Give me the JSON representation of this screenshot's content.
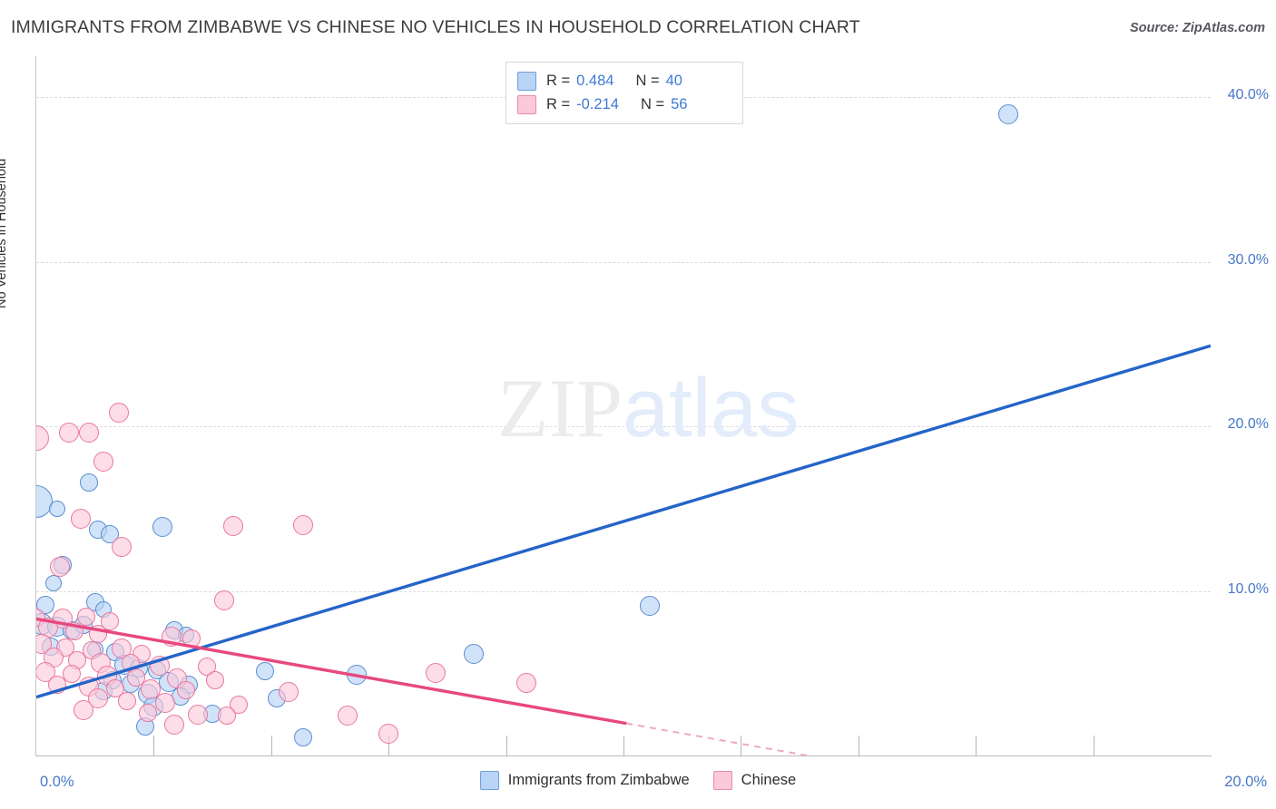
{
  "header": {
    "title": "IMMIGRANTS FROM ZIMBABWE VS CHINESE NO VEHICLES IN HOUSEHOLD CORRELATION CHART",
    "source": "Source: ZipAtlas.com"
  },
  "watermark": {
    "part1": "ZIP",
    "part2": "atlas"
  },
  "stats": {
    "rows": [
      {
        "color": "blue",
        "r_label": "R =",
        "r_value": "0.484",
        "n_label": "N =",
        "n_value": "40"
      },
      {
        "color": "pink",
        "r_label": "R =",
        "r_value": "-0.214",
        "n_label": "N =",
        "n_value": "56"
      }
    ]
  },
  "legend": {
    "items": [
      {
        "label": "Immigrants from Zimbabwe",
        "color": "blue",
        "hex": "#bad4f5"
      },
      {
        "label": "Chinese",
        "color": "pink",
        "hex": "#fbc9d9"
      }
    ]
  },
  "colors": {
    "blue_fill": "#bad4f5",
    "blue_stroke": "#5b8ed0",
    "blue_line": "#2564c8",
    "pink_fill": "#fbc9d9",
    "pink_stroke": "#e8789f",
    "pink_line": "#e8487f",
    "tick_text": "#4777c8",
    "grid": "#dcdcdc"
  },
  "chart_data": {
    "type": "scatter",
    "title": "IMMIGRANTS FROM ZIMBABWE VS CHINESE NO VEHICLES IN HOUSEHOLD CORRELATION CHART",
    "xlabel": "",
    "ylabel": "No Vehicles in Household",
    "xlim": [
      0.0,
      20.0
    ],
    "ylim": [
      0.0,
      42.5
    ],
    "x_ticks": [
      0.0,
      20.0
    ],
    "x_tick_labels": [
      "0.0%",
      "20.0%"
    ],
    "x_minor_ticks": [
      2.0,
      4.0,
      6.0,
      8.0,
      10.0,
      12.0,
      14.0,
      16.0,
      18.0
    ],
    "y_ticks": [
      10.0,
      20.0,
      30.0,
      40.0
    ],
    "y_tick_labels": [
      "10.0%",
      "20.0%",
      "30.0%",
      "40.0%"
    ],
    "grid": "horizontal-dashed",
    "legend_position": "bottom-center",
    "series": [
      {
        "name": "Immigrants from Zimbabwe",
        "color": "#bad4f5",
        "r": 0.484,
        "n": 40,
        "trendline": {
          "x0": 0.0,
          "y0": 3.55,
          "x1": 20.0,
          "y1": 24.9,
          "style": "solid",
          "color": "#2564c8"
        },
        "points": [
          {
            "x": 16.55,
            "y": 38.95,
            "r": 11
          },
          {
            "x": 0.0,
            "y": 15.45,
            "r": 18
          },
          {
            "x": 0.9,
            "y": 16.6,
            "r": 10
          },
          {
            "x": 0.35,
            "y": 15.0,
            "r": 9
          },
          {
            "x": 2.15,
            "y": 13.9,
            "r": 11
          },
          {
            "x": 1.05,
            "y": 13.75,
            "r": 10
          },
          {
            "x": 1.25,
            "y": 13.45,
            "r": 10
          },
          {
            "x": 0.45,
            "y": 11.55,
            "r": 10
          },
          {
            "x": 0.3,
            "y": 10.45,
            "r": 9
          },
          {
            "x": 0.15,
            "y": 9.15,
            "r": 10
          },
          {
            "x": 1.0,
            "y": 9.3,
            "r": 10
          },
          {
            "x": 1.15,
            "y": 8.9,
            "r": 9
          },
          {
            "x": 10.45,
            "y": 9.1,
            "r": 11
          },
          {
            "x": 0.1,
            "y": 8.0,
            "r": 12
          },
          {
            "x": 0.35,
            "y": 7.85,
            "r": 11
          },
          {
            "x": 0.6,
            "y": 7.6,
            "r": 10
          },
          {
            "x": 0.8,
            "y": 7.95,
            "r": 10
          },
          {
            "x": 2.35,
            "y": 7.6,
            "r": 10
          },
          {
            "x": 2.55,
            "y": 7.35,
            "r": 9
          },
          {
            "x": 0.25,
            "y": 6.6,
            "r": 10
          },
          {
            "x": 1.0,
            "y": 6.45,
            "r": 9
          },
          {
            "x": 1.35,
            "y": 6.3,
            "r": 10
          },
          {
            "x": 7.45,
            "y": 6.2,
            "r": 11
          },
          {
            "x": 1.5,
            "y": 5.5,
            "r": 11
          },
          {
            "x": 1.75,
            "y": 5.3,
            "r": 10
          },
          {
            "x": 2.05,
            "y": 5.2,
            "r": 10
          },
          {
            "x": 3.9,
            "y": 5.1,
            "r": 10
          },
          {
            "x": 5.45,
            "y": 4.9,
            "r": 11
          },
          {
            "x": 1.3,
            "y": 4.55,
            "r": 10
          },
          {
            "x": 1.6,
            "y": 4.35,
            "r": 10
          },
          {
            "x": 2.25,
            "y": 4.45,
            "r": 11
          },
          {
            "x": 2.6,
            "y": 4.3,
            "r": 10
          },
          {
            "x": 1.15,
            "y": 3.9,
            "r": 10
          },
          {
            "x": 1.9,
            "y": 3.75,
            "r": 11
          },
          {
            "x": 2.45,
            "y": 3.6,
            "r": 10
          },
          {
            "x": 4.1,
            "y": 3.45,
            "r": 10
          },
          {
            "x": 2.0,
            "y": 2.95,
            "r": 11
          },
          {
            "x": 3.0,
            "y": 2.55,
            "r": 10
          },
          {
            "x": 1.85,
            "y": 1.75,
            "r": 10
          },
          {
            "x": 4.55,
            "y": 1.1,
            "r": 10
          }
        ]
      },
      {
        "name": "Chinese",
        "color": "#fbc9d9",
        "r": -0.214,
        "n": 56,
        "trendline": {
          "x0": 0.0,
          "y0": 8.3,
          "x1": 10.05,
          "y1": 1.95,
          "style": "solid",
          "color": "#e8487f"
        },
        "trendline_dashed": {
          "x0": 10.05,
          "y0": 1.95,
          "x1": 13.2,
          "y1": -0.05,
          "style": "dashed",
          "color": "#eda9c0"
        },
        "points": [
          {
            "x": 1.4,
            "y": 20.85,
            "r": 11
          },
          {
            "x": 0.0,
            "y": 19.3,
            "r": 14
          },
          {
            "x": 0.55,
            "y": 19.6,
            "r": 11
          },
          {
            "x": 0.9,
            "y": 19.6,
            "r": 11
          },
          {
            "x": 1.15,
            "y": 17.85,
            "r": 11
          },
          {
            "x": 0.75,
            "y": 14.4,
            "r": 11
          },
          {
            "x": 3.35,
            "y": 13.95,
            "r": 11
          },
          {
            "x": 4.55,
            "y": 14.0,
            "r": 11
          },
          {
            "x": 1.45,
            "y": 12.7,
            "r": 11
          },
          {
            "x": 0.4,
            "y": 11.45,
            "r": 11
          },
          {
            "x": 3.2,
            "y": 9.45,
            "r": 11
          },
          {
            "x": 0.0,
            "y": 8.4,
            "r": 10
          },
          {
            "x": 0.45,
            "y": 8.35,
            "r": 11
          },
          {
            "x": 0.85,
            "y": 8.45,
            "r": 10
          },
          {
            "x": 1.25,
            "y": 8.15,
            "r": 10
          },
          {
            "x": 0.2,
            "y": 7.75,
            "r": 11
          },
          {
            "x": 0.65,
            "y": 7.55,
            "r": 10
          },
          {
            "x": 1.05,
            "y": 7.4,
            "r": 10
          },
          {
            "x": 2.3,
            "y": 7.2,
            "r": 11
          },
          {
            "x": 2.65,
            "y": 7.1,
            "r": 10
          },
          {
            "x": 0.1,
            "y": 6.8,
            "r": 11
          },
          {
            "x": 0.5,
            "y": 6.55,
            "r": 10
          },
          {
            "x": 0.95,
            "y": 6.4,
            "r": 10
          },
          {
            "x": 1.45,
            "y": 6.5,
            "r": 11
          },
          {
            "x": 1.8,
            "y": 6.2,
            "r": 10
          },
          {
            "x": 0.3,
            "y": 5.95,
            "r": 11
          },
          {
            "x": 0.7,
            "y": 5.8,
            "r": 10
          },
          {
            "x": 1.1,
            "y": 5.6,
            "r": 11
          },
          {
            "x": 1.6,
            "y": 5.65,
            "r": 10
          },
          {
            "x": 2.1,
            "y": 5.45,
            "r": 11
          },
          {
            "x": 2.9,
            "y": 5.4,
            "r": 10
          },
          {
            "x": 0.15,
            "y": 5.05,
            "r": 11
          },
          {
            "x": 0.6,
            "y": 4.95,
            "r": 10
          },
          {
            "x": 1.2,
            "y": 4.85,
            "r": 11
          },
          {
            "x": 1.7,
            "y": 4.75,
            "r": 10
          },
          {
            "x": 2.4,
            "y": 4.7,
            "r": 11
          },
          {
            "x": 3.05,
            "y": 4.6,
            "r": 10
          },
          {
            "x": 6.8,
            "y": 5.0,
            "r": 11
          },
          {
            "x": 0.35,
            "y": 4.3,
            "r": 10
          },
          {
            "x": 0.9,
            "y": 4.2,
            "r": 11
          },
          {
            "x": 1.35,
            "y": 4.1,
            "r": 10
          },
          {
            "x": 1.95,
            "y": 4.0,
            "r": 11
          },
          {
            "x": 2.55,
            "y": 3.95,
            "r": 10
          },
          {
            "x": 4.3,
            "y": 3.85,
            "r": 11
          },
          {
            "x": 8.35,
            "y": 4.4,
            "r": 11
          },
          {
            "x": 1.05,
            "y": 3.5,
            "r": 11
          },
          {
            "x": 1.55,
            "y": 3.3,
            "r": 10
          },
          {
            "x": 2.2,
            "y": 3.2,
            "r": 11
          },
          {
            "x": 3.45,
            "y": 3.1,
            "r": 10
          },
          {
            "x": 0.8,
            "y": 2.75,
            "r": 11
          },
          {
            "x": 1.9,
            "y": 2.6,
            "r": 10
          },
          {
            "x": 2.75,
            "y": 2.5,
            "r": 11
          },
          {
            "x": 3.25,
            "y": 2.4,
            "r": 10
          },
          {
            "x": 5.3,
            "y": 2.45,
            "r": 11
          },
          {
            "x": 2.35,
            "y": 1.85,
            "r": 11
          },
          {
            "x": 6.0,
            "y": 1.3,
            "r": 11
          }
        ]
      }
    ]
  }
}
